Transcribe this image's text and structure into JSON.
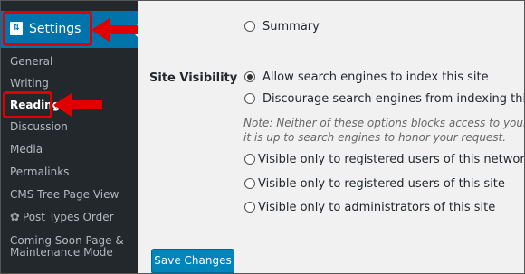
{
  "sidebar": {
    "settings_label": "Settings",
    "settings_icon_glyph": "⇅",
    "items": [
      {
        "label": "General"
      },
      {
        "label": "Writing"
      },
      {
        "label": "Reading"
      },
      {
        "label": "Discussion"
      },
      {
        "label": "Media"
      },
      {
        "label": "Permalinks"
      },
      {
        "label": "CMS Tree Page View"
      },
      {
        "label": "Post Types Order"
      },
      {
        "label": "Coming Soon Page &"
      },
      {
        "label": "Maintenance Mode"
      }
    ],
    "current_item": "Reading"
  },
  "main": {
    "summary_option": "Summary",
    "site_visibility_label": "Site Visibility",
    "visibility_options": [
      {
        "label": "Allow search engines to index this site",
        "checked": true
      },
      {
        "label": "Discourage search engines from indexing this site",
        "checked": false
      }
    ],
    "note_line1": "Note: Neither of these options blocks access to your site",
    "note_line2": "it is up to search engines to honor your request.",
    "restricted_options": [
      {
        "label": "Visible only to registered users of this network"
      },
      {
        "label": "Visible only to registered users of this site"
      },
      {
        "label": "Visible only to administrators of this site"
      }
    ],
    "save_label": "Save Changes"
  },
  "colors": {
    "sidebar_bg": "#23282d",
    "active_bg": "#0073aa",
    "annotation_red": "#e00000",
    "button_blue": "#0085ba"
  }
}
